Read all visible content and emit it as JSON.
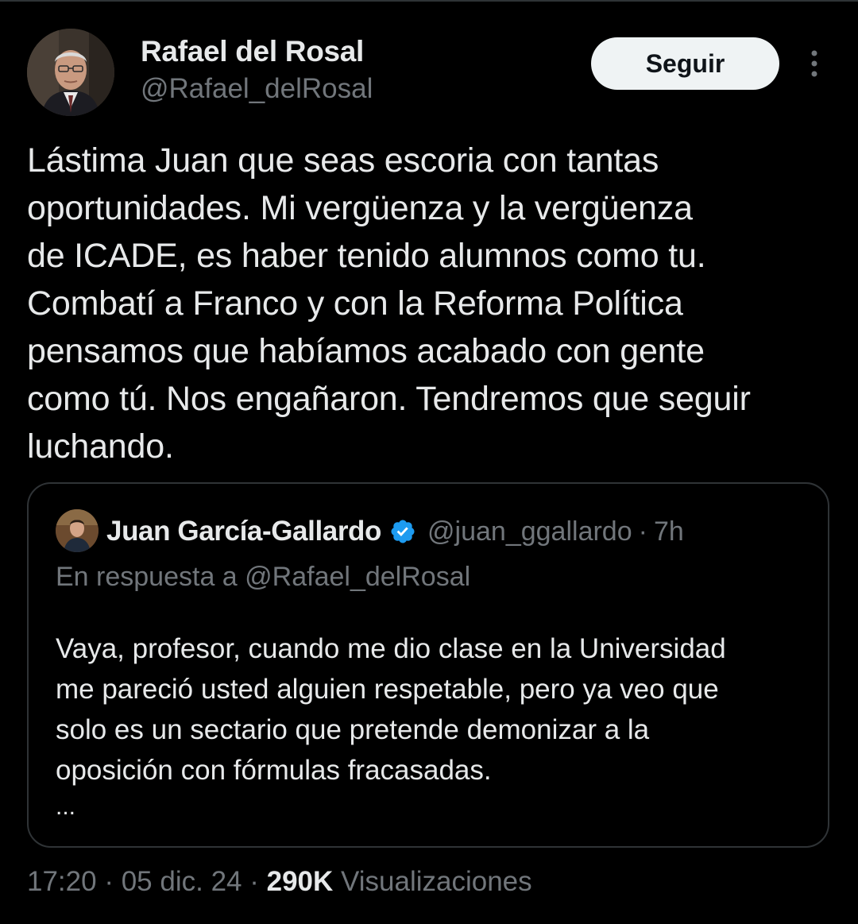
{
  "tweet": {
    "author": {
      "name": "Rafael del Rosal",
      "handle": "@Rafael_delRosal",
      "avatar_icon": "profile-photo"
    },
    "follow_label": "Seguir",
    "more_icon": "more-vertical-icon",
    "text_lines": [
      "Lástima Juan que seas escoria con tantas",
      "oportunidades. Mi vergüenza y la vergüenza",
      "de ICADE, es haber tenido alumnos como tu.",
      "Combatí a Franco y con la Reforma Política",
      "pensamos que habíamos acabado con gente",
      "como tú. Nos engañaron. Tendremos que seguir",
      "luchando."
    ],
    "quote": {
      "author_name": "Juan García-Gallardo",
      "verified_icon": "verified-badge-icon",
      "handle": "@juan_ggallardo",
      "separator": "·",
      "time": "7h",
      "reply_to": "En respuesta a @Rafael_delRosal",
      "text_lines": [
        "Vaya, profesor, cuando me dio clase en la Universidad",
        "me pareció usted alguien respetable, pero ya veo que",
        "solo es un sectario que pretende demonizar a la",
        "oposición con fórmulas fracasadas."
      ],
      "ellipsis": "..."
    },
    "footer": {
      "time": "17:20",
      "sep1": "·",
      "date": "05 dic. 24",
      "sep2": "·",
      "views_count": "290K",
      "views_label": "Visualizaciones"
    }
  },
  "colors": {
    "background": "#000000",
    "text_primary": "#e7e9ea",
    "text_secondary": "#71767b",
    "border": "#2f3336",
    "button_bg": "#eff3f4",
    "verified_blue": "#1d9bf0"
  }
}
